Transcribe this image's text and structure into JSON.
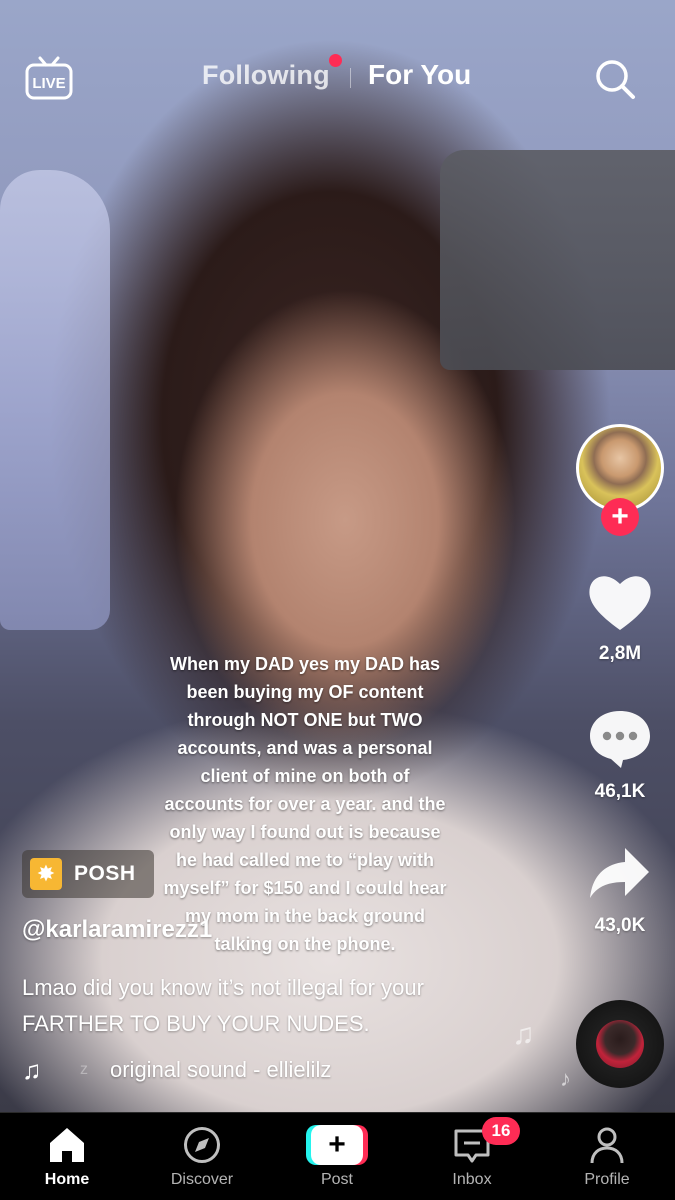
{
  "top_nav": {
    "live_label": "LIVE",
    "tabs": [
      {
        "label": "Following",
        "active": false,
        "has_notification_dot": true
      },
      {
        "label": "For You",
        "active": true
      }
    ],
    "search_icon": "search-icon"
  },
  "video": {
    "caption_overlay": "When my DAD yes my DAD has been buying my OF content through NOT ONE but TWO accounts, and was a personal client of mine on both of accounts for over a year. and the only way I found out is because he had called me to “play with myself” for $150 and I could hear my mom in the back ground talking on the phone."
  },
  "actions": {
    "likes": "2,8M",
    "comments": "46,1K",
    "shares": "43,0K",
    "follow_icon": "plus-icon"
  },
  "post_info": {
    "badge_label": "POSH",
    "username": "@karlaramirezz1",
    "description": "Lmao did you know it’s not illegal for your FARTHER TO BUY YOUR NUDES.",
    "sound_prefix": "z",
    "sound": "original sound - ellielilz"
  },
  "tabbar": {
    "items": [
      {
        "label": "Home",
        "icon": "home-icon",
        "active": true
      },
      {
        "label": "Discover",
        "icon": "compass-icon",
        "active": false
      },
      {
        "label": "Post",
        "icon": "plus-icon",
        "active": false
      },
      {
        "label": "Inbox",
        "icon": "inbox-icon",
        "active": false,
        "badge": "16"
      },
      {
        "label": "Profile",
        "icon": "person-icon",
        "active": false
      }
    ]
  },
  "colors": {
    "accent": "#fe2c55",
    "post_cyan": "#25f4ee",
    "tabbar_bg": "#000000"
  }
}
